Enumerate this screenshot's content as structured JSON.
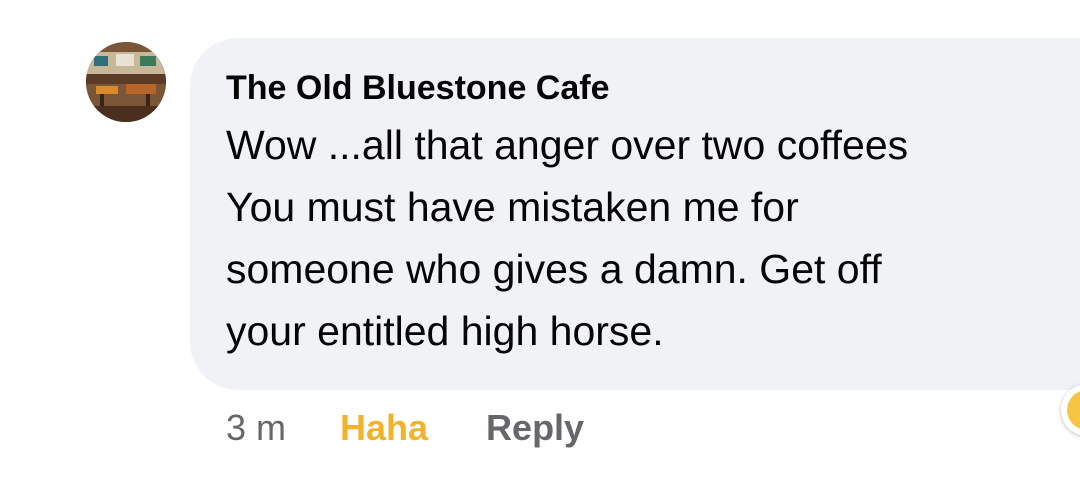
{
  "comment": {
    "author": "The Old Bluestone Cafe",
    "text_lines": [
      "Wow ...all that anger over two coffees",
      "You must have mistaken me for",
      "someone who gives a damn. Get off",
      "your entitled high horse."
    ],
    "timestamp": "3 m",
    "reaction_label": "Haha",
    "reply_label": "Reply",
    "reaction_icon": "haha-emoji-icon"
  },
  "colors": {
    "bubble_bg": "#f0f2f5",
    "text": "#050505",
    "meta": "#65676b",
    "haha": "#f0b32b"
  }
}
